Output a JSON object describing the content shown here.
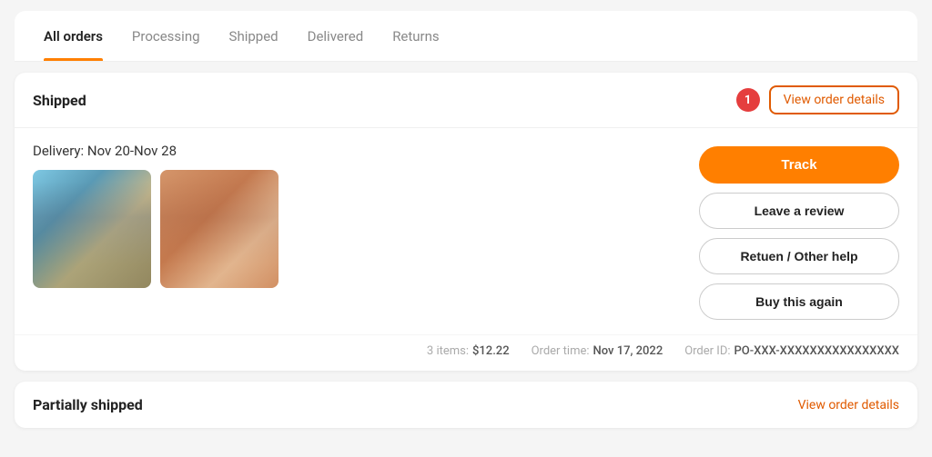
{
  "tabs": {
    "items": [
      {
        "id": "all-orders",
        "label": "All orders",
        "active": true
      },
      {
        "id": "processing",
        "label": "Processing",
        "active": false
      },
      {
        "id": "shipped",
        "label": "Shipped",
        "active": false
      },
      {
        "id": "delivered",
        "label": "Delivered",
        "active": false
      },
      {
        "id": "returns",
        "label": "Returns",
        "active": false
      }
    ]
  },
  "order_card": {
    "status": "Shipped",
    "badge_count": "1",
    "view_details_label": "View order details",
    "delivery_date": "Delivery: Nov 20-Nov 28",
    "btn_track": "Track",
    "btn_review": "Leave a review",
    "btn_return": "Retuen / Other help",
    "btn_buy_again": "Buy this again",
    "footer": {
      "items_label": "3 items:",
      "items_price": "$12.22",
      "order_time_label": "Order time:",
      "order_time_value": "Nov 17, 2022",
      "order_id_label": "Order ID:",
      "order_id_value": "PO-XXX-XXXXXXXXXXXXXXXX"
    }
  },
  "partial_card": {
    "status": "Partially shipped",
    "view_details_label": "View order details"
  }
}
